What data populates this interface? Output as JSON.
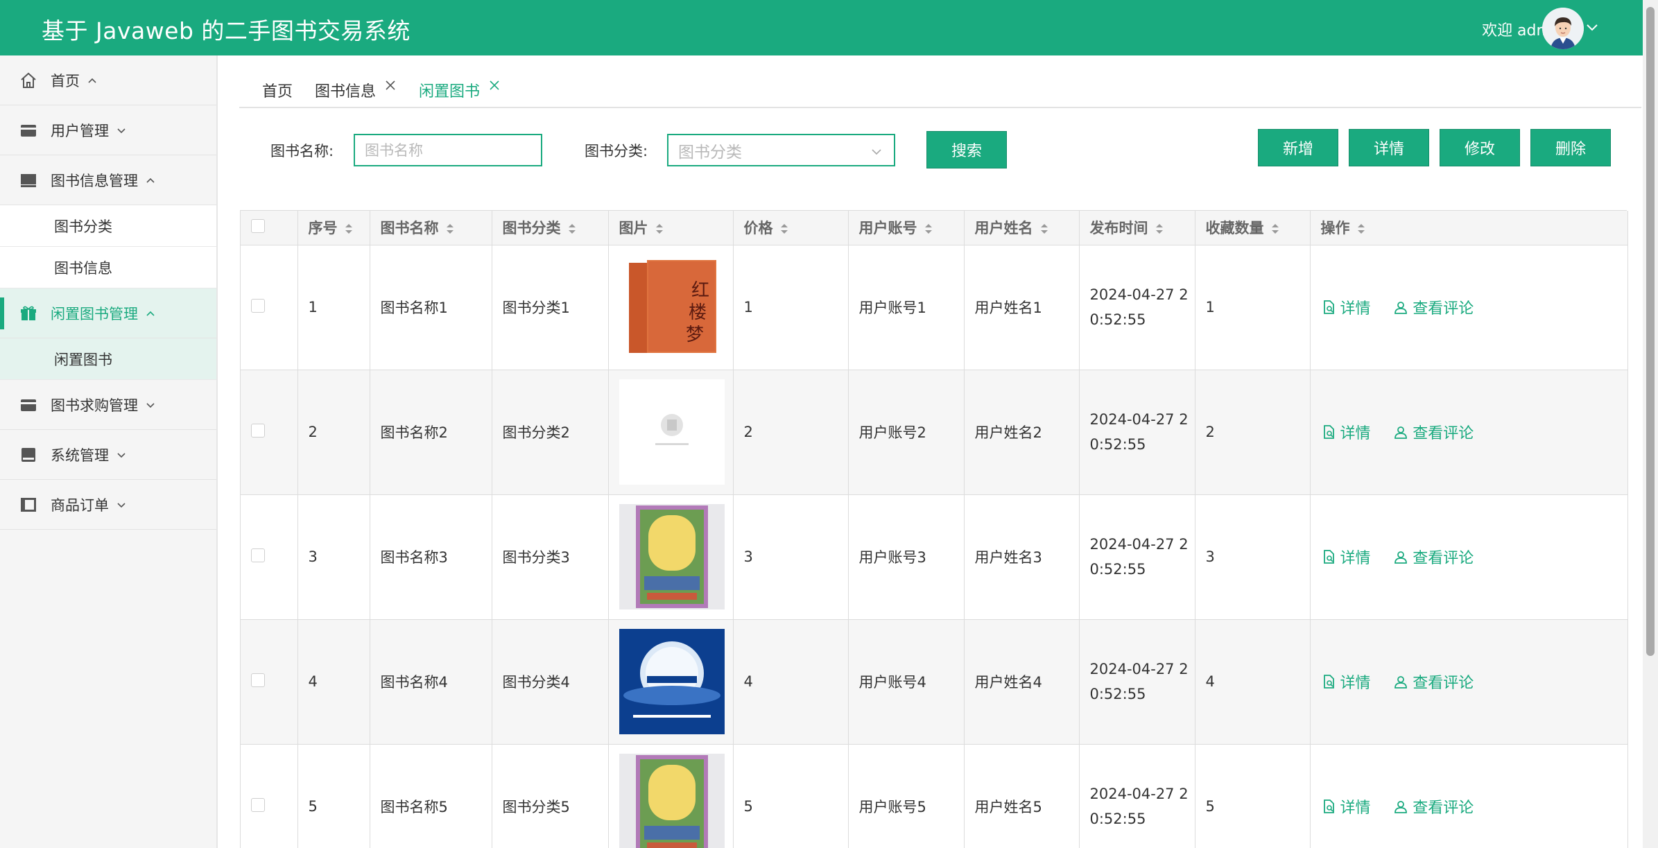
{
  "header": {
    "title": "基于 Javaweb 的二手图书交易系统",
    "welcome": "欢迎 admin"
  },
  "sidebar": {
    "items": [
      {
        "label": "首页",
        "icon": "home-icon"
      },
      {
        "label": "用户管理",
        "icon": "wallet-icon"
      },
      {
        "label": "图书信息管理",
        "icon": "monitor-icon"
      },
      {
        "label": "图书分类"
      },
      {
        "label": "图书信息"
      },
      {
        "label": "闲置图书管理",
        "icon": "gift-icon"
      },
      {
        "label": "闲置图书"
      },
      {
        "label": "图书求购管理",
        "icon": "wallet-icon"
      },
      {
        "label": "系统管理",
        "icon": "drive-icon"
      },
      {
        "label": "商品订单",
        "icon": "sidebar-panel-icon"
      }
    ]
  },
  "tabs": [
    {
      "label": "首页"
    },
    {
      "label": "图书信息"
    },
    {
      "label": "闲置图书"
    }
  ],
  "search": {
    "name_label": "图书名称:",
    "name_placeholder": "图书名称",
    "category_label": "图书分类:",
    "category_placeholder": "图书分类",
    "search_button": "搜索"
  },
  "actions": {
    "add": "新增",
    "detail": "详情",
    "edit": "修改",
    "delete": "删除"
  },
  "table": {
    "columns": [
      "序号",
      "图书名称",
      "图书分类",
      "图片",
      "价格",
      "用户账号",
      "用户姓名",
      "发布时间",
      "收藏数量",
      "操作"
    ],
    "op_detail": "详情",
    "op_comments": "查看评论",
    "rows": [
      {
        "no": "1",
        "name": "图书名称1",
        "category": "图书分类1",
        "price": "1",
        "account": "用户账号1",
        "username": "用户姓名1",
        "time_a": "2024-04-27 2",
        "time_b": "0:52:55",
        "favorites": "1"
      },
      {
        "no": "2",
        "name": "图书名称2",
        "category": "图书分类2",
        "price": "2",
        "account": "用户账号2",
        "username": "用户姓名2",
        "time_a": "2024-04-27 2",
        "time_b": "0:52:55",
        "favorites": "2"
      },
      {
        "no": "3",
        "name": "图书名称3",
        "category": "图书分类3",
        "price": "3",
        "account": "用户账号3",
        "username": "用户姓名3",
        "time_a": "2024-04-27 2",
        "time_b": "0:52:55",
        "favorites": "3"
      },
      {
        "no": "4",
        "name": "图书名称4",
        "category": "图书分类4",
        "price": "4",
        "account": "用户账号4",
        "username": "用户姓名4",
        "time_a": "2024-04-27 2",
        "time_b": "0:52:55",
        "favorites": "4"
      },
      {
        "no": "5",
        "name": "图书名称5",
        "category": "图书分类5",
        "price": "5",
        "account": "用户账号5",
        "username": "用户姓名5",
        "time_a": "2024-04-27 2",
        "time_b": "0:52:55",
        "favorites": "5"
      }
    ]
  },
  "colors": {
    "primary": "#1aaa7f",
    "active_bg": "#e4f3ee"
  }
}
